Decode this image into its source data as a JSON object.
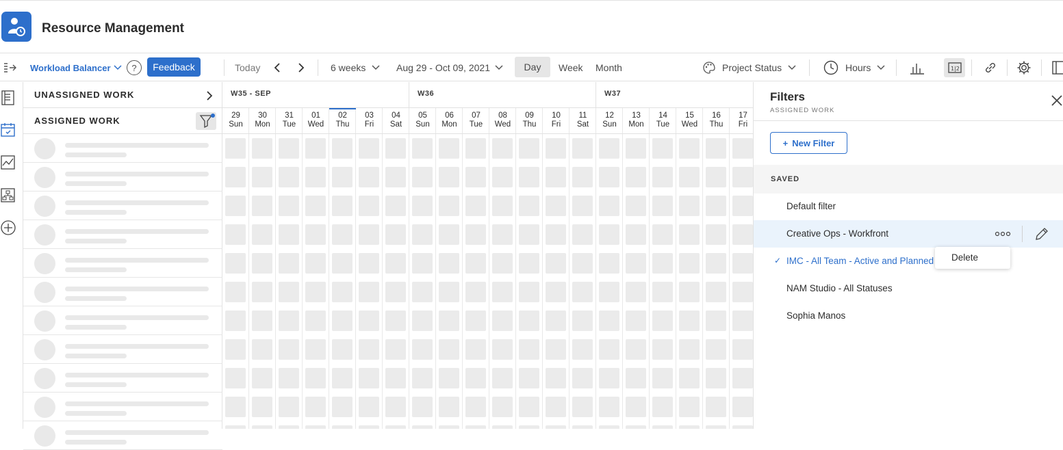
{
  "app": {
    "title": "Resource Management"
  },
  "toolbar": {
    "workload_balancer": "Workload Balancer",
    "help": "?",
    "feedback": "Feedback",
    "today": "Today",
    "range": "6 weeks",
    "dates": "Aug 29 - Oct 09, 2021",
    "view_day": "Day",
    "view_week": "Week",
    "view_month": "Month",
    "project_status": "Project Status",
    "hours": "Hours"
  },
  "grid": {
    "unassigned": "UNASSIGNED WORK",
    "assigned": "ASSIGNED WORK",
    "weeks": [
      "W35 - SEP",
      "W36",
      "W37"
    ],
    "days": [
      {
        "num": "29",
        "name": "Sun"
      },
      {
        "num": "30",
        "name": "Mon"
      },
      {
        "num": "31",
        "name": "Tue"
      },
      {
        "num": "01",
        "name": "Wed"
      },
      {
        "num": "02",
        "name": "Thu"
      },
      {
        "num": "03",
        "name": "Fri"
      },
      {
        "num": "04",
        "name": "Sat"
      },
      {
        "num": "05",
        "name": "Sun"
      },
      {
        "num": "06",
        "name": "Mon"
      },
      {
        "num": "07",
        "name": "Tue"
      },
      {
        "num": "08",
        "name": "Wed"
      },
      {
        "num": "09",
        "name": "Thu"
      },
      {
        "num": "10",
        "name": "Fri"
      },
      {
        "num": "11",
        "name": "Sat"
      },
      {
        "num": "12",
        "name": "Sun"
      },
      {
        "num": "13",
        "name": "Mon"
      },
      {
        "num": "14",
        "name": "Tue"
      },
      {
        "num": "15",
        "name": "Wed"
      },
      {
        "num": "16",
        "name": "Thu"
      },
      {
        "num": "17",
        "name": "Fri"
      }
    ]
  },
  "panel": {
    "title": "Filters",
    "subtitle": "ASSIGNED WORK",
    "new_filter": "New Filter",
    "saved": "SAVED",
    "items": [
      "Default filter",
      "Creative Ops - Workfront",
      "IMC - All Team - Active and Planned",
      "NAM Studio - All Statuses",
      "Sophia Manos"
    ],
    "context_delete": "Delete"
  },
  "colors": {
    "accent": "#2d6fcb",
    "placeholder": "#ebebeb",
    "hover": "#eaf3fc"
  }
}
